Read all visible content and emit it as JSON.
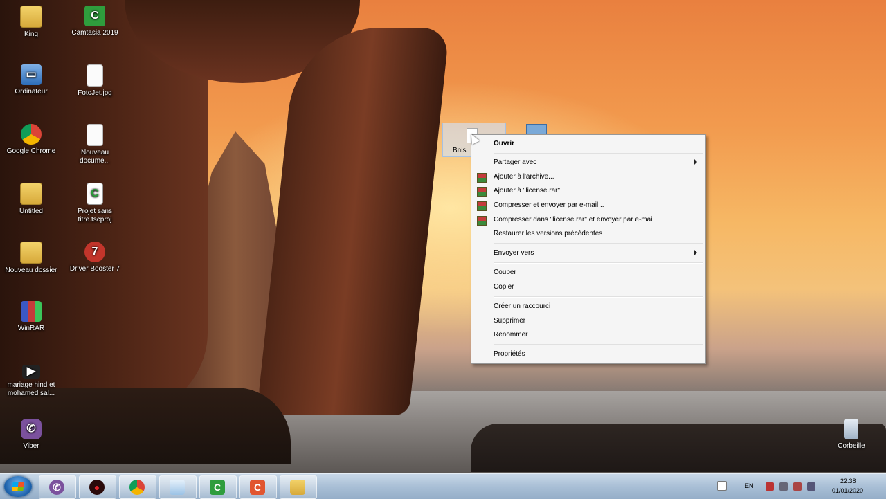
{
  "desktop": {
    "icons": [
      {
        "label": "King"
      },
      {
        "label": "Camtasia 2019"
      },
      {
        "label": "Ordinateur"
      },
      {
        "label": "FotoJet.jpg"
      },
      {
        "label": "Google Chrome"
      },
      {
        "label": "Nouveau docume..."
      },
      {
        "label": "Untitled"
      },
      {
        "label": "Projet sans titre.tscproj"
      },
      {
        "label": "Nouveau dossier"
      },
      {
        "label": "Driver Booster 7"
      },
      {
        "label": "WinRAR"
      },
      {
        "label": "mariage hind et mohamed sal..."
      },
      {
        "label": "Viber"
      },
      {
        "label": "Corbeille"
      }
    ],
    "selected_file": {
      "label": "Bnis"
    }
  },
  "context_menu": {
    "items": [
      {
        "label": "Ouvrir"
      },
      {
        "label": "Partager avec"
      },
      {
        "label": "Ajouter à l'archive..."
      },
      {
        "label": "Ajouter à \"license.rar\""
      },
      {
        "label": "Compresser et envoyer par e-mail..."
      },
      {
        "label": "Compresser dans \"license.rar\" et envoyer par e-mail"
      },
      {
        "label": "Restaurer les versions précédentes"
      },
      {
        "label": "Envoyer vers"
      },
      {
        "label": "Couper"
      },
      {
        "label": "Copier"
      },
      {
        "label": "Créer un raccourci"
      },
      {
        "label": "Supprimer"
      },
      {
        "label": "Renommer"
      },
      {
        "label": "Propriétés"
      }
    ]
  },
  "taskbar": {
    "apps": [
      "start-orb",
      "viber-icon",
      "record-icon",
      "chrome-icon",
      "app-icon",
      "camtasia-icon",
      "camtasia-recorder-icon",
      "explorer-icon"
    ],
    "tray": {
      "language": "EN",
      "time": "22:38",
      "date": "01/01/2020"
    }
  }
}
